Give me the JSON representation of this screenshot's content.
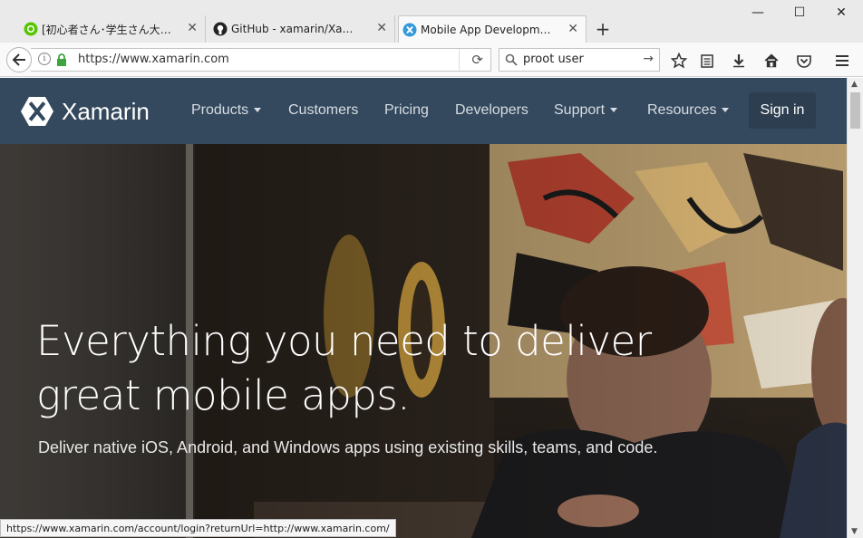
{
  "browser": {
    "tabs": [
      {
        "title": "[初心者さん･学生さん大歓...",
        "favicon": "qiita-icon",
        "active": false
      },
      {
        "title": "GitHub - xamarin/Xamarin...",
        "favicon": "github-icon",
        "active": false
      },
      {
        "title": "Mobile App Development ...",
        "favicon": "xamarin-icon",
        "active": true
      }
    ],
    "new_tab_label": "+",
    "window_controls": {
      "minimize": "—",
      "maximize": "☐",
      "close": "✕"
    },
    "url": "https://www.xamarin.com",
    "search": {
      "value": "proot user"
    },
    "status_url": "https://www.xamarin.com/account/login?returnUrl=http://www.xamarin.com/"
  },
  "site": {
    "logo_text": "Xamarin",
    "nav": [
      {
        "label": "Products",
        "dropdown": true
      },
      {
        "label": "Customers",
        "dropdown": false
      },
      {
        "label": "Pricing",
        "dropdown": false
      },
      {
        "label": "Developers",
        "dropdown": false
      },
      {
        "label": "Support",
        "dropdown": true
      },
      {
        "label": "Resources",
        "dropdown": true
      }
    ],
    "signin_label": "Sign in"
  },
  "hero": {
    "title_line1": "Everything you need to deliver",
    "title_line2": "great mobile apps.",
    "subtitle": "Deliver native iOS, Android, and Windows apps using existing skills, teams, and code."
  },
  "colors": {
    "header_bg": "#34495e",
    "signin_bg": "#2c3e50",
    "xamarin_blue": "#3498db",
    "secure_green": "#3fa33f"
  }
}
